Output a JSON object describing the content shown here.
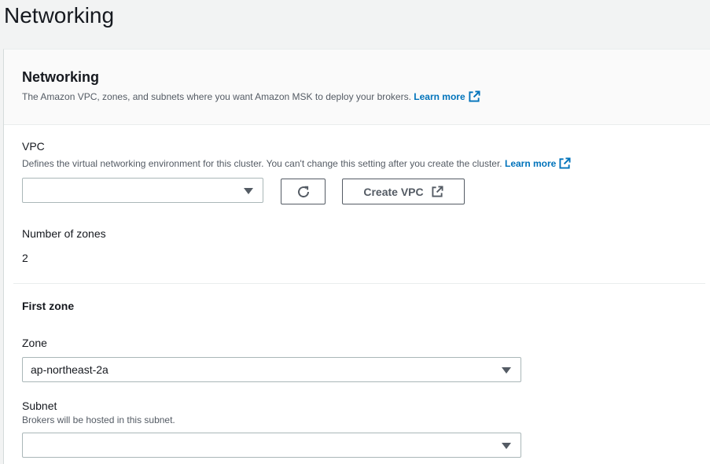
{
  "page": {
    "title": "Networking"
  },
  "panel": {
    "title": "Networking",
    "description": "The Amazon VPC, zones, and subnets where you want Amazon MSK to deploy your brokers.",
    "learn_more": "Learn more"
  },
  "vpc": {
    "label": "VPC",
    "description": "Defines the virtual networking environment for this cluster. You can't change this setting after you create the cluster.",
    "learn_more": "Learn more",
    "selected": "",
    "create_button": "Create VPC"
  },
  "zones": {
    "label": "Number of zones",
    "value": "2"
  },
  "first_zone": {
    "title": "First zone",
    "zone_label": "Zone",
    "zone_value": "ap-northeast-2a",
    "subnet_label": "Subnet",
    "subnet_description": "Brokers will be hosted in this subnet.",
    "subnet_value": ""
  },
  "colors": {
    "link": "#0073bb",
    "text": "#16191f",
    "secondary_text": "#545b64",
    "border": "#aab7b8"
  }
}
